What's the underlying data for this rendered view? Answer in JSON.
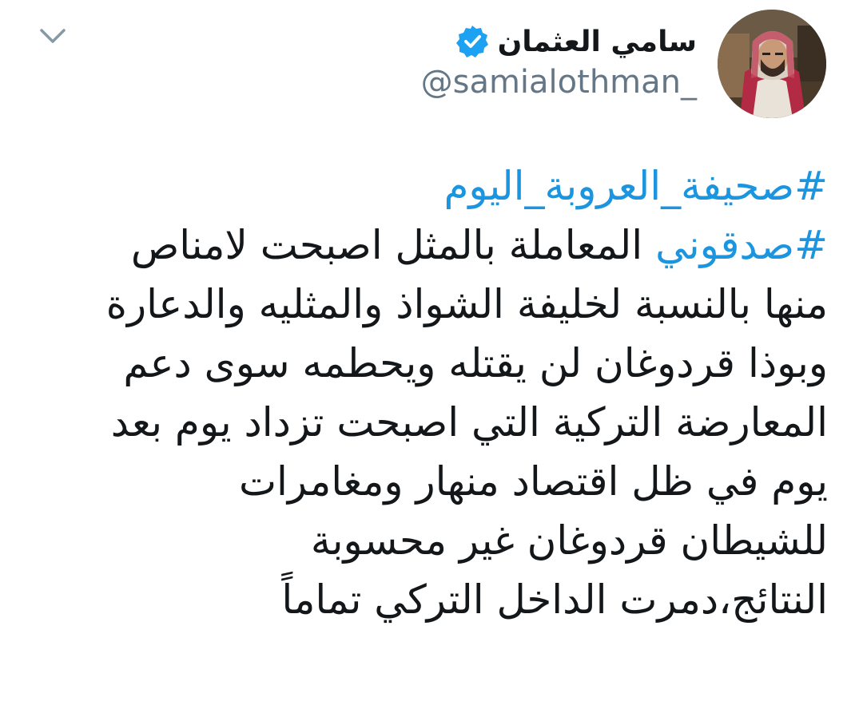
{
  "author": {
    "display_name": "سامي العثمان",
    "handle": "@samialothman_",
    "verified": true
  },
  "tweet": {
    "hashtag_1": "#صحيفة_العروبة_اليوم",
    "hashtag_2": "#صدقوني",
    "line_2_rest": " المعاملة بالمثل اصبحت لامناص",
    "lines": [
      "منها بالنسبة لخليفة الشواذ والمثليه والدعارة",
      "وبوذا قردوغان لن يقتله ويحطمه سوى دعم",
      "المعارضة التركية التي اصبحت تزداد يوم بعد",
      "يوم في ظل اقتصاد منهار ومغامرات",
      "للشيطان قردوغان غير محسوبة",
      "النتائج،دمرت الداخل التركي تماماً"
    ]
  },
  "colors": {
    "hashtag": "#1b95e0",
    "text": "#14171a",
    "handle": "#657786",
    "verified": "#1da1f2"
  },
  "icons": {
    "menu": "chevron-down-icon",
    "verified": "verified-badge-icon"
  }
}
